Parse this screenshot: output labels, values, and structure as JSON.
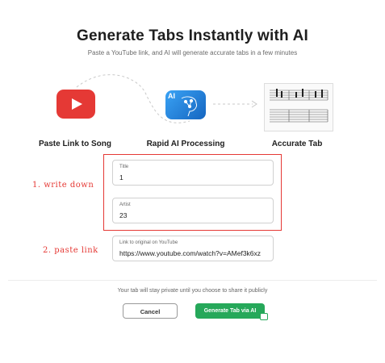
{
  "header": {
    "title": "Generate Tabs Instantly with AI",
    "subtitle": "Paste a YouTube link, and AI will generate accurate tabs in a few minutes"
  },
  "steps": [
    {
      "label": "Paste Link to Song",
      "icon": "youtube-icon"
    },
    {
      "label": "Rapid AI Processing",
      "icon": "ai-brain-icon",
      "icon_text": "AI"
    },
    {
      "label": "Accurate Tab",
      "icon": "guitar-tab-icon"
    }
  ],
  "form": {
    "title": {
      "label": "Title",
      "value": "1"
    },
    "artist": {
      "label": "Artist",
      "value": "23"
    },
    "link": {
      "label": "Link to original on YouTube",
      "value": "https://www.youtube.com/watch?v=AMef3k6xz"
    }
  },
  "annotations": {
    "step1": "1. write down",
    "step2": "2. paste link"
  },
  "footer": {
    "privacy": "Your tab will stay private until you choose to share it publicly",
    "cancel": "Cancel",
    "generate": "Generate Tab via AI"
  },
  "colors": {
    "accent_green": "#26a85a",
    "annotation_red": "#e53935",
    "youtube_red": "#e53935",
    "ai_blue": "#1e88e5"
  }
}
